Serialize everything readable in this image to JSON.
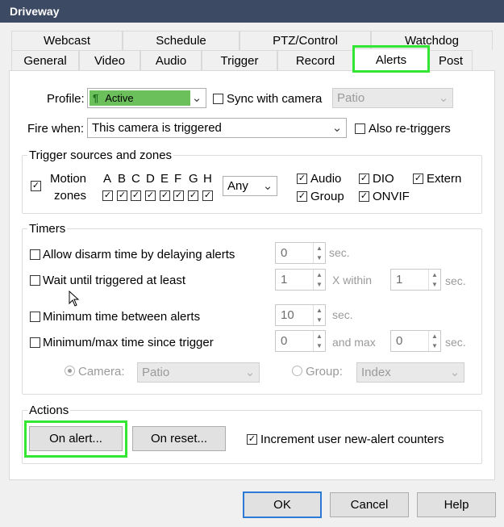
{
  "window": {
    "title": "Driveway"
  },
  "tabs": {
    "back": [
      "Webcast",
      "Schedule",
      "PTZ/Control",
      "Watchdog"
    ],
    "front": [
      "General",
      "Video",
      "Audio",
      "Trigger",
      "Record",
      "Alerts",
      "Post"
    ],
    "active": "Alerts"
  },
  "profile": {
    "label": "Profile:",
    "value": "Active",
    "color": "#6cc05c",
    "sync_label": "Sync with camera",
    "sync_checked": false,
    "camera": "Patio"
  },
  "fire_when": {
    "label": "Fire when:",
    "value": "This camera is triggered",
    "also_label": "Also re-triggers",
    "also_checked": false
  },
  "trigger_sources": {
    "title": "Trigger sources and zones",
    "motion_label": "Motion",
    "zones_label": "zones",
    "motion_checked": true,
    "zones": [
      "A",
      "B",
      "C",
      "D",
      "E",
      "F",
      "G",
      "H"
    ],
    "zones_checked": [
      true,
      true,
      true,
      true,
      true,
      true,
      true,
      true
    ],
    "match": "Any",
    "audio": "Audio",
    "dio": "DIO",
    "extern": "Extern",
    "group": "Group",
    "onvif": "ONVIF",
    "audio_checked": true,
    "dio_checked": true,
    "extern_checked": true,
    "group_checked": true,
    "onvif_checked": true
  },
  "timers": {
    "title": "Timers",
    "disarm_label": "Allow disarm time by delaying alerts",
    "disarm_value": "0",
    "wait_label": "Wait until triggered at least",
    "wait_value": "1",
    "x_within": "X within",
    "within_value": "1",
    "min_between_label": "Minimum time between alerts",
    "min_between_value": "10",
    "minmax_label": "Minimum/max time since trigger",
    "min_value": "0",
    "and_max": "and max",
    "max_value": "0",
    "sec": "sec.",
    "camera_label": "Camera:",
    "camera_value": "Patio",
    "group_label": "Group:",
    "group_value": "Index"
  },
  "actions": {
    "title": "Actions",
    "on_alert": "On alert...",
    "on_reset": "On reset...",
    "increment_label": "Increment user new-alert counters",
    "increment_checked": true
  },
  "buttons": {
    "ok": "OK",
    "cancel": "Cancel",
    "help": "Help"
  }
}
